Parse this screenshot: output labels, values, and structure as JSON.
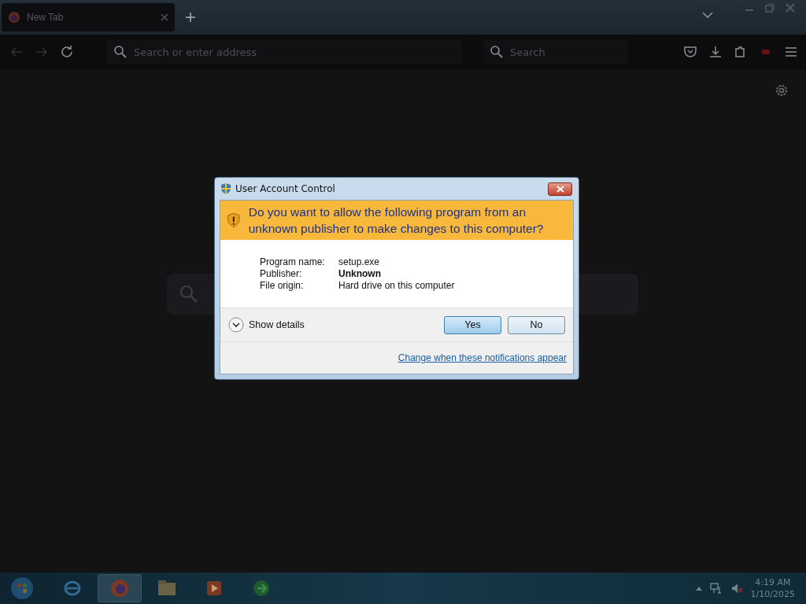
{
  "browser": {
    "tabs": [
      {
        "label": "New Tab",
        "selected": true
      }
    ],
    "address_bar": {
      "placeholder": "Search or enter address"
    },
    "search_bar": {
      "placeholder": "Search"
    }
  },
  "dialog": {
    "title": "User Account Control",
    "question": "Do you want to allow the following program from an unknown publisher to make changes to this computer?",
    "details": [
      {
        "label": "Program name:",
        "value": "setup.exe",
        "bold": false
      },
      {
        "label": "Publisher:",
        "value": "Unknown",
        "bold": true
      },
      {
        "label": "File origin:",
        "value": "Hard drive on this computer",
        "bold": false
      }
    ],
    "show_details": "Show details",
    "buttons": [
      {
        "label": "Yes",
        "default": true
      },
      {
        "label": "No",
        "default": false
      }
    ],
    "link": "Change when these notifications appear"
  },
  "taskbar": {
    "apps": [
      {
        "kind": "ie",
        "selected": false
      },
      {
        "kind": "firefox",
        "selected": true
      },
      {
        "kind": "folder",
        "selected": false
      },
      {
        "kind": "media",
        "selected": false
      },
      {
        "kind": "green",
        "selected": false
      }
    ],
    "clock": {
      "time": "4:19 AM",
      "date": "1/10/2025"
    }
  }
}
